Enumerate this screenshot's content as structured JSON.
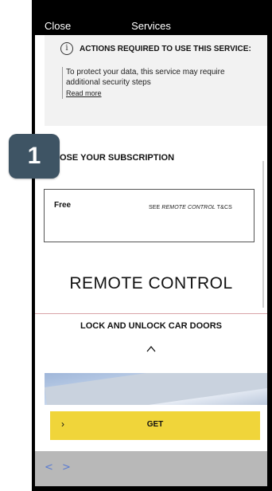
{
  "header": {
    "close_label": "Close",
    "title": "Services"
  },
  "notice": {
    "icon": "info-icon",
    "heading": "ACTIONS REQUIRED TO USE THIS SERVICE:",
    "body": "To protect your data, this service may require additional security steps",
    "link": "Read more"
  },
  "subscription": {
    "heading": "OSE YOUR SUBSCRIPTION",
    "plan_name": "Free",
    "terms_prefix": "SEE ",
    "terms_emphasis": "REMOTE CONTROL",
    "terms_suffix": " T&CS"
  },
  "service": {
    "name": "REMOTE CONTROL",
    "feature": "LOCK AND UNLOCK CAR DOORS",
    "expand_icon": "chevron-up-icon"
  },
  "cta": {
    "chevron": "›",
    "label": "GET"
  },
  "bottom_nav": {
    "back": "<",
    "forward": ">"
  },
  "badge": {
    "number": "1"
  },
  "colors": {
    "accent": "#f0d53a",
    "badge": "#3e5464",
    "nav": "#5a7bd1",
    "divider": "#d9a3a8"
  }
}
